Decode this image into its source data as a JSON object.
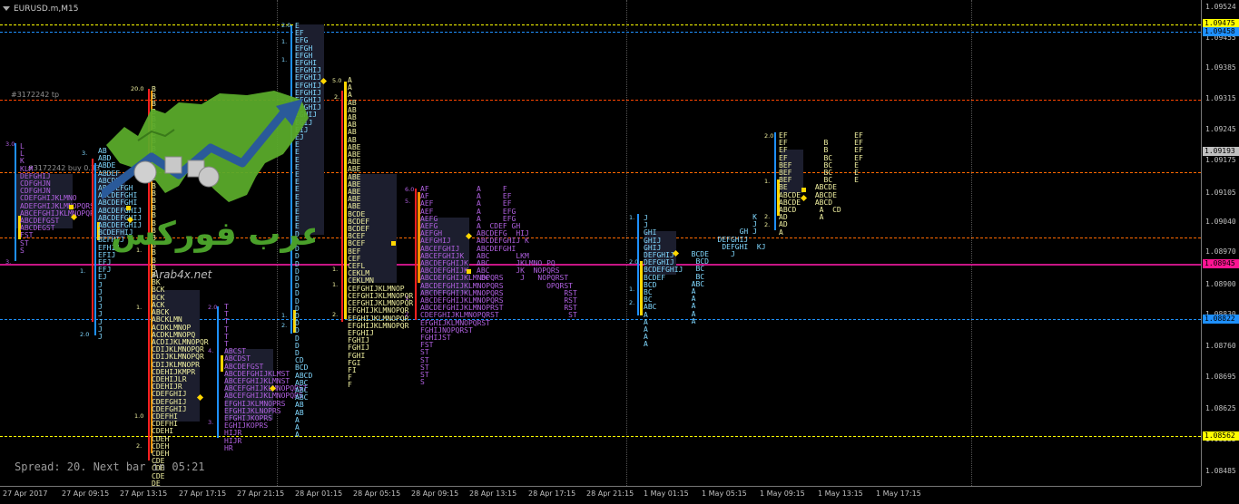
{
  "window": {
    "symbol_label": "EURUSD.m,M15",
    "spread_text": "Spread: 20. Next bar in 05:21"
  },
  "chart_labels": {
    "tp_label": "#3172242 tp",
    "buy_label": "#3172242 buy 0.33"
  },
  "logo": {
    "text_arabic": "عرب فوركس",
    "text_url": "Arab4x.net"
  },
  "price_axis": {
    "ticks": [
      "1.09524",
      "1.09455",
      "1.09385",
      "1.09315",
      "1.09245",
      "1.09175",
      "1.09105",
      "1.09040",
      "1.08970",
      "1.08900",
      "1.08830",
      "1.08760",
      "1.08695",
      "1.08625",
      "1.08555",
      "1.08485"
    ],
    "tags": [
      {
        "value": "1.09475",
        "color": "#ffff00"
      },
      {
        "value": "1.09458",
        "color": "#1e90ff"
      },
      {
        "value": "1.09193",
        "color": "#c0c0c0"
      },
      {
        "value": "1.08945",
        "color": "#ff1493"
      },
      {
        "value": "1.08822",
        "color": "#1e90ff"
      },
      {
        "value": "1.08562",
        "color": "#ffff00"
      }
    ]
  },
  "time_axis": {
    "labels": [
      "27 Apr 2017",
      "27 Apr 09:15",
      "27 Apr 13:15",
      "27 Apr 17:15",
      "27 Apr 21:15",
      "28 Apr 01:15",
      "28 Apr 05:15",
      "28 Apr 09:15",
      "28 Apr 13:15",
      "28 Apr 17:15",
      "28 Apr 21:15",
      "1 May 01:15",
      "1 May 05:15",
      "1 May 09:15",
      "1 May 13:15",
      "1 May 17:15"
    ]
  },
  "colors": {
    "yellow": "#ffff00",
    "blue": "#1e90ff",
    "magenta": "#ff1493",
    "orange": "#ff8c00",
    "red": "#ff2020",
    "cyan": "#40c0ff",
    "profile_yellow": "#f0f0a0",
    "profile_purple": "#b060e0",
    "profile_cyan": "#80d8ff"
  }
}
